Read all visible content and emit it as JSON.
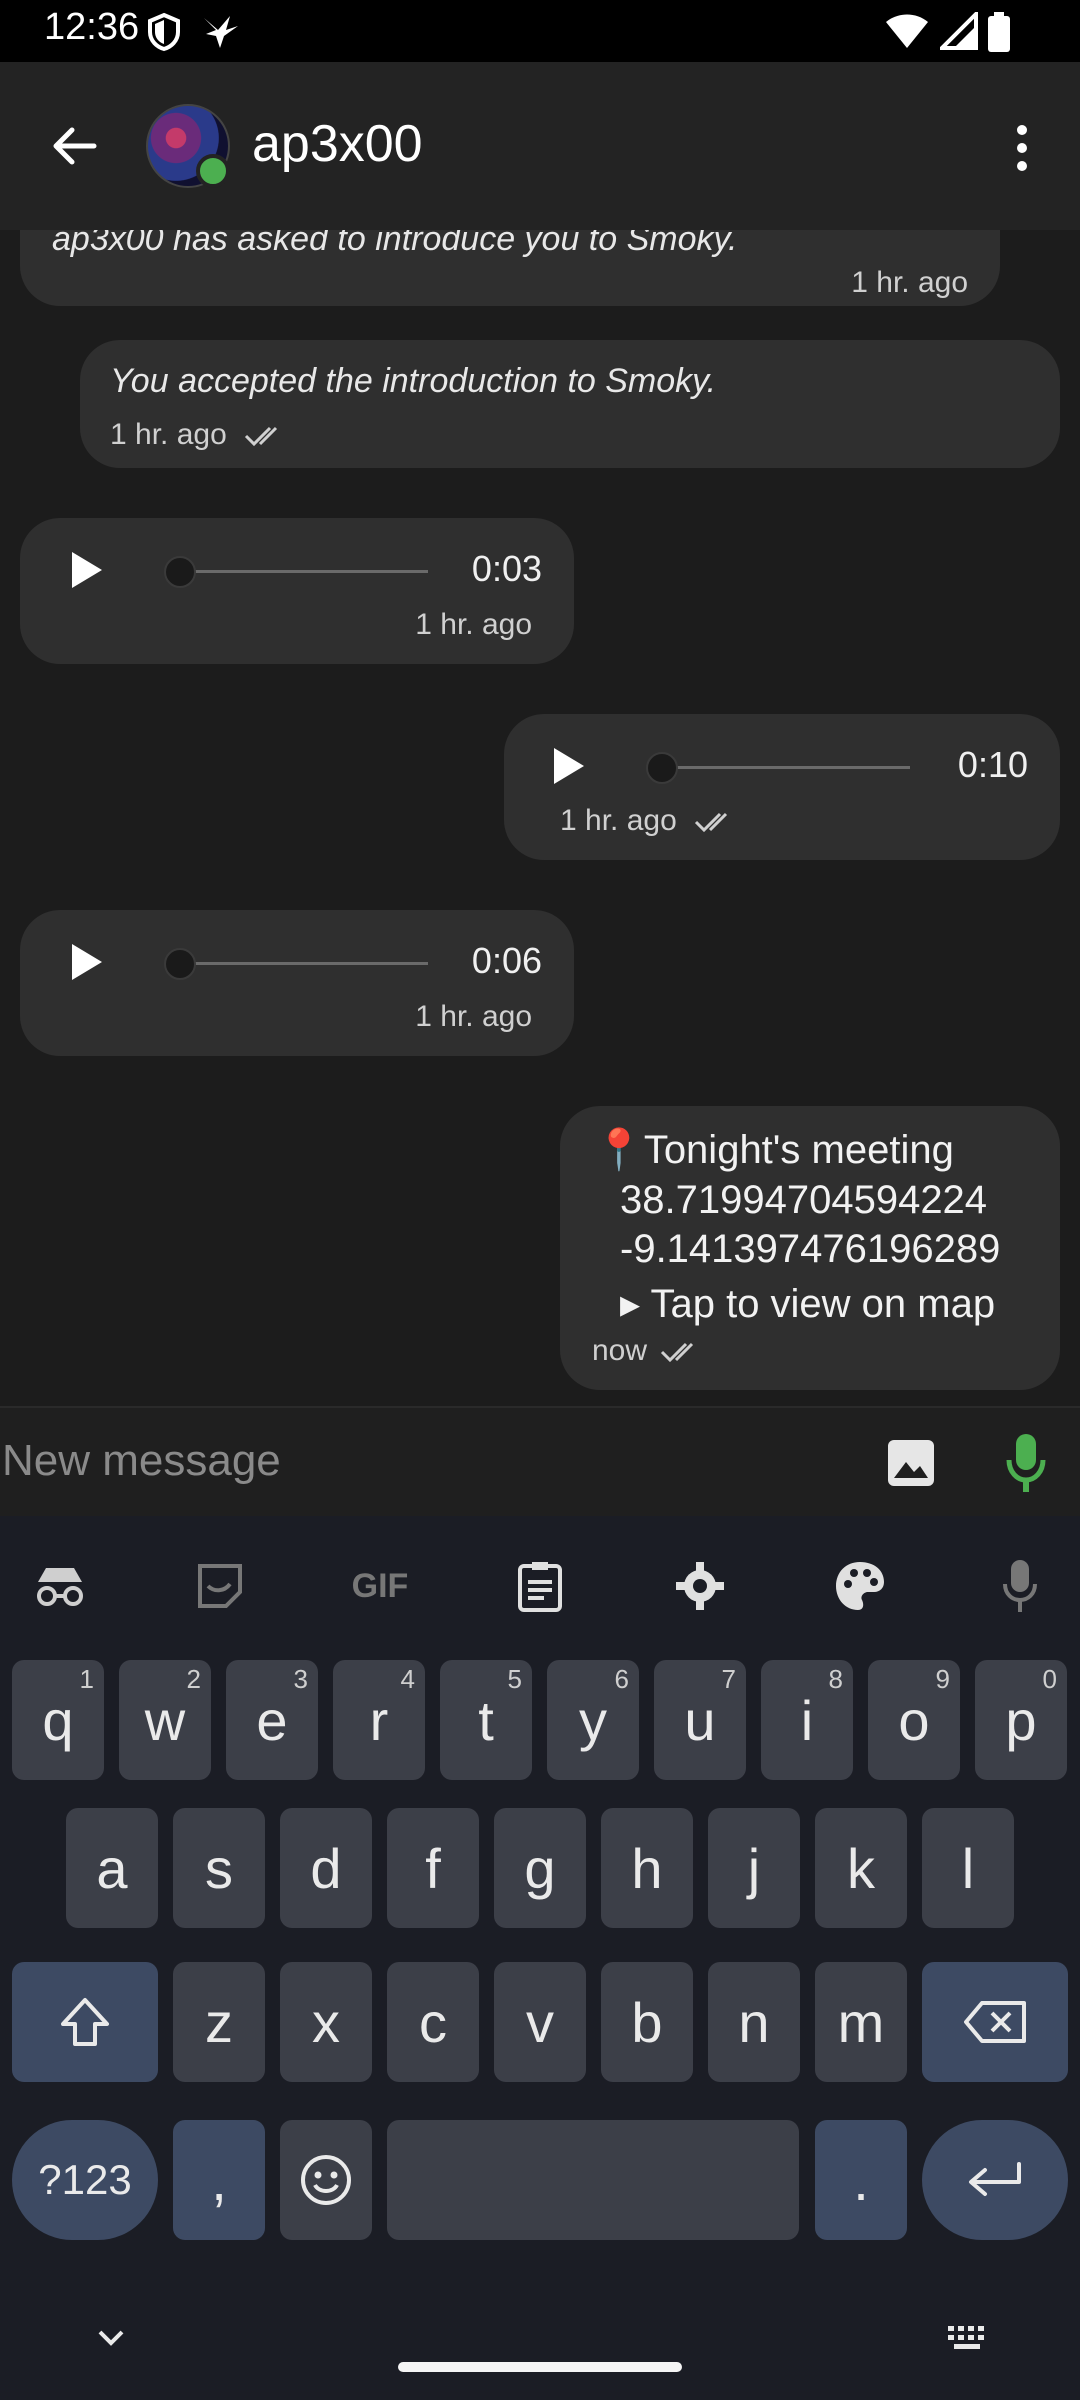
{
  "status_bar": {
    "time": "12:36",
    "icons": [
      "shield-icon",
      "bird-icon",
      "wifi-icon",
      "signal-icon",
      "battery-icon"
    ]
  },
  "app_bar": {
    "title": "ap3x00",
    "back_icon": "arrow-left-icon",
    "menu_icon": "more-vertical-icon",
    "online_color": "#4caf50"
  },
  "messages": [
    {
      "type": "system",
      "text": "ap3x00 has asked to introduce you to Smoky.",
      "time": "1 hr. ago",
      "direction": "incoming"
    },
    {
      "type": "system",
      "text": "You accepted the introduction to Smoky.",
      "time": "1 hr. ago",
      "direction": "outgoing"
    },
    {
      "type": "audio",
      "duration": "0:03",
      "time": "1 hr. ago",
      "direction": "incoming"
    },
    {
      "type": "audio",
      "duration": "0:10",
      "time": "1 hr. ago",
      "direction": "outgoing"
    },
    {
      "type": "audio",
      "duration": "0:06",
      "time": "1 hr. ago",
      "direction": "incoming"
    },
    {
      "type": "location",
      "pin": "📍",
      "label": "Tonight's meeting",
      "lat": "38.71994704594224",
      "lon": "-9.141397476196289",
      "action": "▸ Tap to view on map",
      "time": "now",
      "direction": "outgoing"
    }
  ],
  "input": {
    "placeholder": "New message",
    "image_icon": "image-icon",
    "mic_icon": "microphone-icon",
    "mic_color": "#4caf50"
  },
  "keyboard": {
    "toolbar": [
      "incognito-icon",
      "sticker-icon",
      "gif-icon",
      "clipboard-icon",
      "settings-icon",
      "palette-icon",
      "microphone-icon"
    ],
    "gif_label": "GIF",
    "row1": [
      {
        "k": "q",
        "h": "1"
      },
      {
        "k": "w",
        "h": "2"
      },
      {
        "k": "e",
        "h": "3"
      },
      {
        "k": "r",
        "h": "4"
      },
      {
        "k": "t",
        "h": "5"
      },
      {
        "k": "y",
        "h": "6"
      },
      {
        "k": "u",
        "h": "7"
      },
      {
        "k": "i",
        "h": "8"
      },
      {
        "k": "o",
        "h": "9"
      },
      {
        "k": "p",
        "h": "0"
      }
    ],
    "row2": [
      "a",
      "s",
      "d",
      "f",
      "g",
      "h",
      "j",
      "k",
      "l"
    ],
    "row3": [
      "z",
      "x",
      "c",
      "v",
      "b",
      "n",
      "m"
    ],
    "symbols_label": "?123",
    "comma": ",",
    "period": ".",
    "accent_color": "#3d4a63"
  }
}
